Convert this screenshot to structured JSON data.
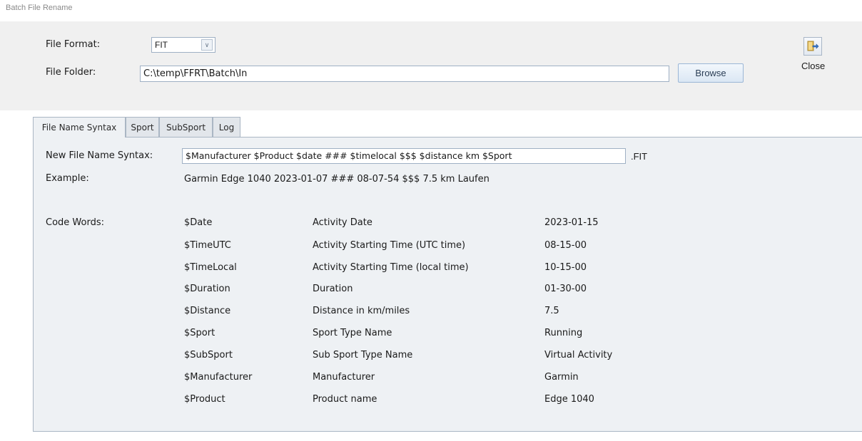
{
  "window": {
    "title": "Batch File Rename"
  },
  "form": {
    "file_format_label": "File Format:",
    "file_format_value": "FIT",
    "file_folder_label": "File Folder:",
    "file_folder_value": "C:\\temp\\FFRT\\Batch\\In",
    "browse_label": "Browse"
  },
  "close": {
    "label": "Close",
    "icon": "exit-door-icon"
  },
  "tabs": [
    {
      "label": "File Name Syntax",
      "active": true
    },
    {
      "label": "Sport",
      "active": false
    },
    {
      "label": "SubSport",
      "active": false
    },
    {
      "label": "Log",
      "active": false
    }
  ],
  "syntax": {
    "label": "New File Name Syntax:",
    "value": "$Manufacturer $Product $date ### $timelocal $$$ $distance km $Sport",
    "extension": ".FIT",
    "example_label": "Example:",
    "example_value": "Garmin Edge 1040 2023-01-07 ### 08-07-54 $$$ 7.5 km Laufen",
    "code_words_label": "Code Words:"
  },
  "code_words": [
    {
      "code": "$Date",
      "description": "Activity Date",
      "example": "2023-01-15"
    },
    {
      "code": "$TimeUTC",
      "description": "Activity Starting Time (UTC time)",
      "example": "08-15-00"
    },
    {
      "code": "$TimeLocal",
      "description": "Activity Starting Time (local time)",
      "example": "10-15-00"
    },
    {
      "code": "$Duration",
      "description": "Duration",
      "example": "01-30-00"
    },
    {
      "code": "$Distance",
      "description": "Distance in km/miles",
      "example": "7.5"
    },
    {
      "code": "$Sport",
      "description": "Sport Type Name",
      "example": "Running"
    },
    {
      "code": "$SubSport",
      "description": "Sub Sport Type Name",
      "example": "Virtual Activity"
    },
    {
      "code": "$Manufacturer",
      "description": "Manufacturer",
      "example": "Garmin"
    },
    {
      "code": "$Product",
      "description": "Product name",
      "example": "Edge 1040"
    }
  ]
}
